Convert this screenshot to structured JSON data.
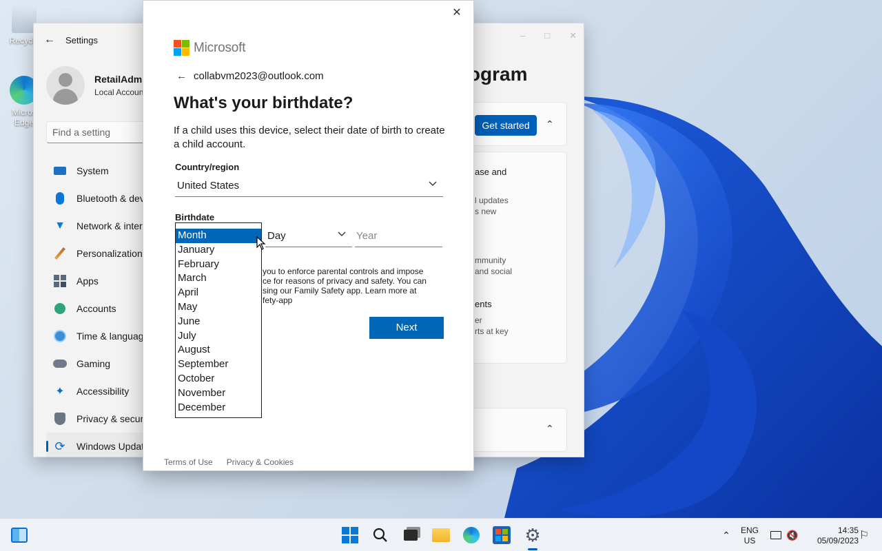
{
  "desktop": {
    "icons": [
      {
        "label": "Recycle",
        "icon": "recycle-bin-icon"
      },
      {
        "label": "Micros\nEdge",
        "icon": "edge-icon"
      }
    ]
  },
  "settings": {
    "title": "Settings",
    "user": {
      "name": "RetailAdmi",
      "account_type": "Local Accoun"
    },
    "search_placeholder": "Find a setting",
    "nav": [
      {
        "label": "System",
        "icon": "system-icon"
      },
      {
        "label": "Bluetooth & dev",
        "icon": "bluetooth-icon"
      },
      {
        "label": "Network & inter",
        "icon": "wifi-icon"
      },
      {
        "label": "Personalization",
        "icon": "brush-icon"
      },
      {
        "label": "Apps",
        "icon": "apps-icon"
      },
      {
        "label": "Accounts",
        "icon": "accounts-icon"
      },
      {
        "label": "Time & languag",
        "icon": "time-language-icon"
      },
      {
        "label": "Gaming",
        "icon": "gaming-icon"
      },
      {
        "label": "Accessibility",
        "icon": "accessibility-icon"
      },
      {
        "label": "Privacy & securi",
        "icon": "shield-icon"
      },
      {
        "label": "Windows Updat",
        "icon": "update-icon"
      }
    ],
    "page_title_fragment": "rogram",
    "get_started_label": "Get started",
    "card_lines": [
      "ase and",
      "l updates",
      "s new",
      "mmunity",
      "and social",
      "ents",
      "er",
      "rts at key"
    ]
  },
  "dialog": {
    "brand": "Microsoft",
    "account_email": "collabvm2023@outlook.com",
    "heading": "What's your birthdate?",
    "description": "If a child uses this device, select their date of birth to create a child account.",
    "country_label": "Country/region",
    "country_value": "United States",
    "birthdate_label": "Birthdate",
    "day_value": "Day",
    "year_placeholder": "Year",
    "fine_print": [
      "you to enforce parental controls and impose",
      "ce for reasons of privacy and safety. You can",
      "sing our Family Safety app. Learn more at",
      "fety-app"
    ],
    "next_label": "Next",
    "footer_terms": "Terms of Use",
    "footer_privacy": "Privacy & Cookies",
    "month_options": [
      "Month",
      "January",
      "February",
      "March",
      "April",
      "May",
      "June",
      "July",
      "August",
      "September",
      "October",
      "November",
      "December"
    ],
    "month_selected_index": 0
  },
  "taskbar": {
    "apps": [
      "widgets-icon",
      "start-icon",
      "search-icon",
      "task-view-icon",
      "file-explorer-icon",
      "edge-icon",
      "store-icon",
      "settings-gear-icon"
    ],
    "language_line1": "ENG",
    "language_line2": "US",
    "time": "14:35",
    "date": "05/09/2023"
  },
  "colors": {
    "accent": "#0067b8",
    "settings_accent": "#005fb8"
  }
}
